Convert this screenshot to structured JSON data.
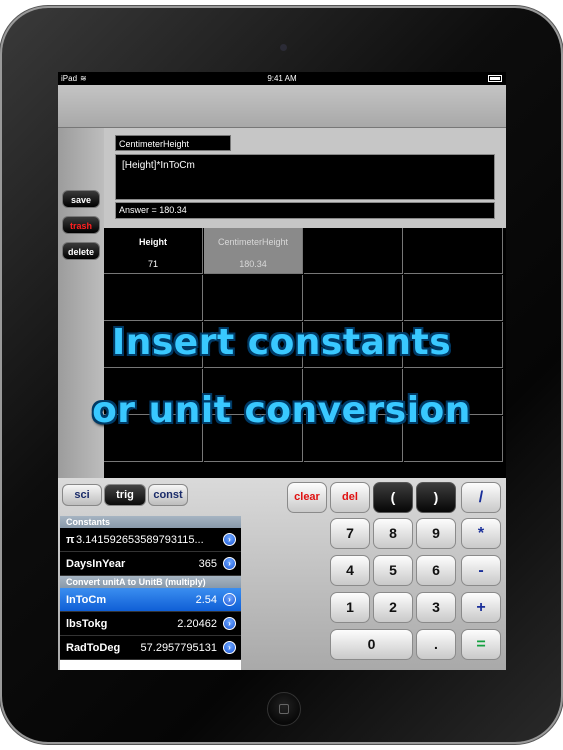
{
  "status_bar": {
    "device": "iPad",
    "wifi_icon": "wifi-icon",
    "time": "9:41 AM"
  },
  "side_buttons": {
    "save": "save",
    "trash": "trash",
    "delete": "delete"
  },
  "formula": {
    "name": "CentimeterHeight",
    "expression": "[Height]*InToCm",
    "answer": "Answer = 180.34"
  },
  "grid": {
    "columns": [
      {
        "header": "Height",
        "value": "71"
      },
      {
        "header": "CentimeterHeight",
        "value": "180.34"
      }
    ]
  },
  "overlay": {
    "line1": "Insert constants",
    "line2": "or unit conversion",
    "color": "#39c8ff"
  },
  "tabs": {
    "sci": "sci",
    "trig": "trig",
    "const": "const",
    "active": "trig"
  },
  "constants": {
    "section1": "Constants",
    "pi_name": "π",
    "pi_value": "3.141592653589793115...",
    "days_name": "DaysInYear",
    "days_value": "365",
    "section2": "Convert unitA to UnitB (multiply)",
    "intocm_name": "InToCm",
    "intocm_value": "2.54",
    "lbs_name": "lbsTokg",
    "lbs_value": "2.20462",
    "rad_name": "RadToDeg",
    "rad_value": "57.2957795131"
  },
  "keypad": {
    "clear": "clear",
    "del": "del",
    "lparen": "(",
    "rparen": ")",
    "divide": "/",
    "k7": "7",
    "k8": "8",
    "k9": "9",
    "multiply": "*",
    "k4": "4",
    "k5": "5",
    "k6": "6",
    "minus": "-",
    "k1": "1",
    "k2": "2",
    "k3": "3",
    "plus": "+",
    "k0": "0",
    "dot": ".",
    "equals": "="
  }
}
